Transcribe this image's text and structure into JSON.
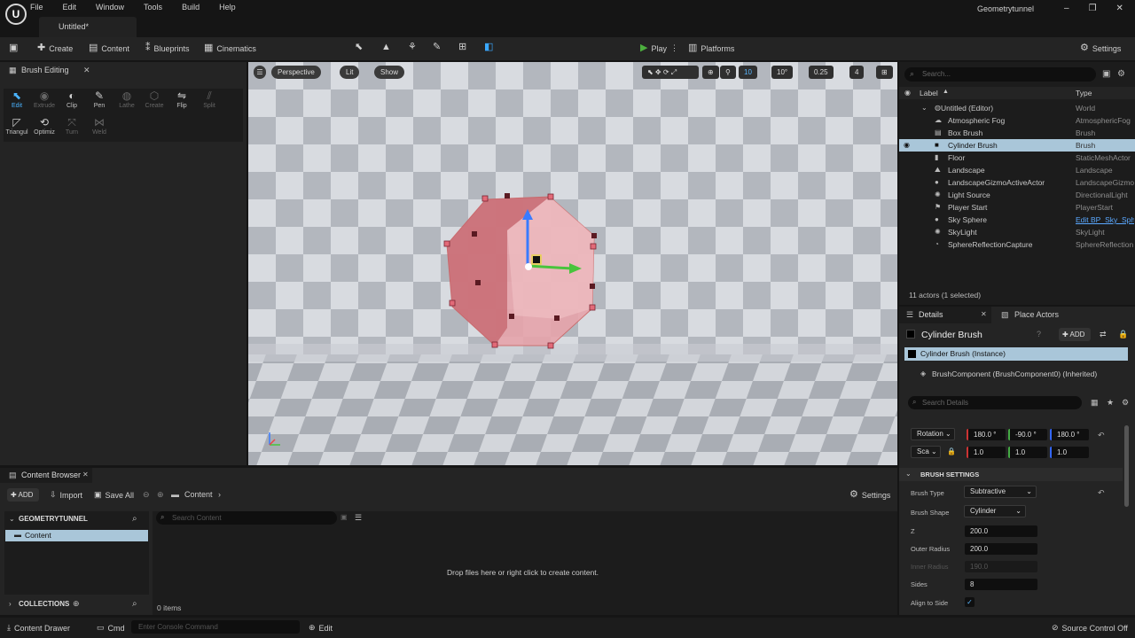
{
  "app": {
    "logo": "U",
    "project": "Geometrytunnel",
    "doc_tab": "Untitled*"
  },
  "menu": [
    "File",
    "Edit",
    "Window",
    "Tools",
    "Build",
    "Help"
  ],
  "toolbar": {
    "save_icon": "save-icon",
    "create": "Create",
    "content": "Content",
    "blueprints": "Blueprints",
    "cinematics": "Cinematics",
    "play": "Play",
    "platforms": "Platforms",
    "settings": "Settings"
  },
  "brush_panel": {
    "tab": "Brush Editing",
    "tools": [
      {
        "label": "Edit",
        "active": true
      },
      {
        "label": "Extrude",
        "dim": true
      },
      {
        "label": "Clip"
      },
      {
        "label": "Pen"
      },
      {
        "label": "Lathe",
        "dim": true
      },
      {
        "label": "Create",
        "dim": true
      },
      {
        "label": "Flip"
      },
      {
        "label": "Split",
        "dim": true
      }
    ],
    "tools2": [
      {
        "label": "Triangul"
      },
      {
        "label": "Optimiz"
      },
      {
        "label": "Turn",
        "dim": true
      },
      {
        "label": "Weld",
        "dim": true
      }
    ]
  },
  "viewport": {
    "perspective": "Perspective",
    "lit": "Lit",
    "show": "Show",
    "grid": "10",
    "angle": "10°",
    "scale": "0.25",
    "cam": "4"
  },
  "outliner": {
    "search_placeholder": "Search...",
    "col_label": "Label",
    "col_type": "Type",
    "rows": [
      {
        "label": "Untitled (Editor)",
        "type": "World",
        "indent": "root"
      },
      {
        "label": "Atmospheric Fog",
        "type": "AtmosphericFog"
      },
      {
        "label": "Box Brush",
        "type": "Brush"
      },
      {
        "label": "Cylinder Brush",
        "type": "Brush",
        "selected": true
      },
      {
        "label": "Floor",
        "type": "StaticMeshActor"
      },
      {
        "label": "Landscape",
        "type": "Landscape"
      },
      {
        "label": "LandscapeGizmoActiveActor",
        "type": "LandscapeGizmo"
      },
      {
        "label": "Light Source",
        "type": "DirectionalLight"
      },
      {
        "label": "Player Start",
        "type": "PlayerStart"
      },
      {
        "label": "Sky Sphere",
        "type": "Edit BP_Sky_Sph",
        "link": true
      },
      {
        "label": "SkyLight",
        "type": "SkyLight"
      },
      {
        "label": "SphereReflectionCapture",
        "type": "SphereReflection"
      }
    ],
    "count": "11 actors (1 selected)"
  },
  "details": {
    "tab": "Details",
    "tab2": "Place Actors",
    "actor": "Cylinder Brush",
    "add": "ADD",
    "instance": "Cylinder Brush (Instance)",
    "component": "BrushComponent (BrushComponent0) (Inherited)",
    "search_placeholder": "Search Details",
    "rotation_label": "Rotation",
    "rot": [
      "180.0 °",
      "-90.0 °",
      "180.0 °"
    ],
    "scale_label": "Sca",
    "scale": [
      "1.0",
      "1.0",
      "1.0"
    ],
    "section": "BRUSH SETTINGS",
    "brush_type_label": "Brush Type",
    "brush_type": "Subtractive",
    "brush_shape_label": "Brush Shape",
    "brush_shape": "Cylinder",
    "z_label": "Z",
    "z": "200.0",
    "outer_label": "Outer Radius",
    "outer": "200.0",
    "inner_label": "Inner Radius",
    "inner": "190.0",
    "sides_label": "Sides",
    "sides": "8",
    "align_label": "Align to Side"
  },
  "content_browser": {
    "tab": "Content Browser",
    "add": "ADD",
    "import": "Import",
    "save_all": "Save All",
    "path": "Content",
    "settings": "Settings",
    "project": "GEOMETRYTUNNEL",
    "folder": "Content",
    "collections": "COLLECTIONS",
    "search_placeholder": "Search Content",
    "drop": "Drop files here or right click to create content.",
    "items": "0 items"
  },
  "status": {
    "drawer": "Content Drawer",
    "cmd": "Cmd",
    "console_placeholder": "Enter Console Command",
    "edit": "Edit",
    "source": "Source Control Off"
  }
}
